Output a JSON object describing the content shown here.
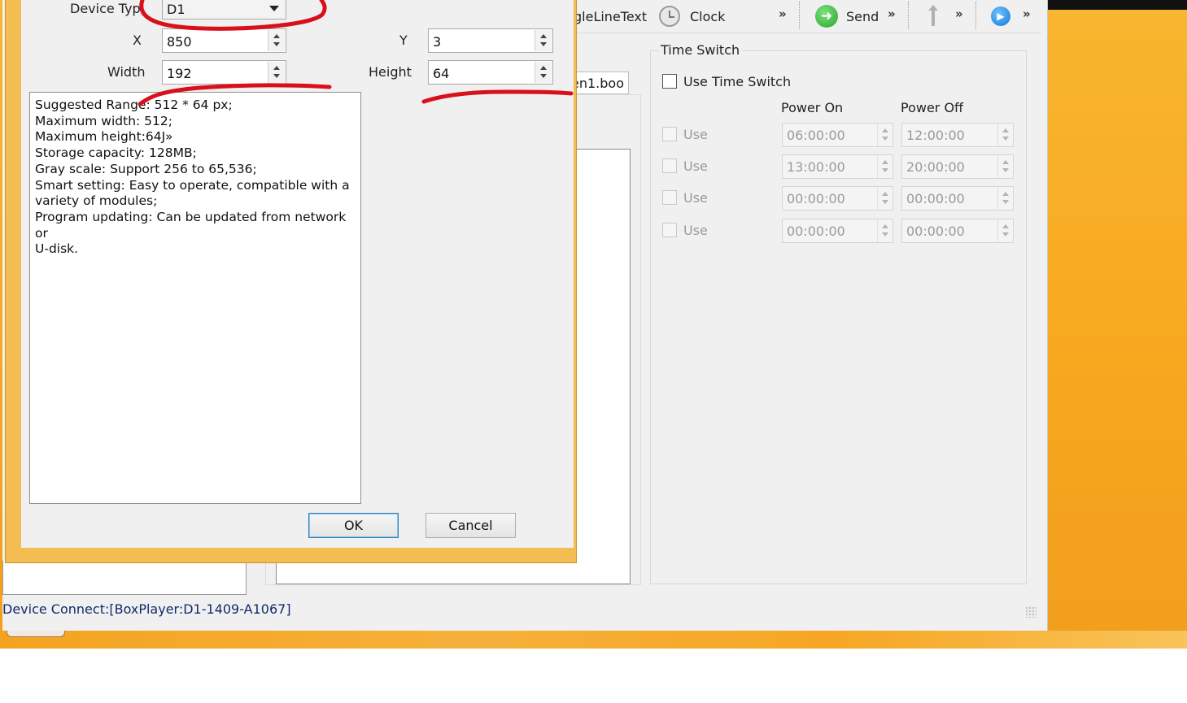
{
  "colors": {
    "desktop": "#f9b630",
    "dialog_frame": "#f3bd52",
    "annotation": "#d8101c",
    "status_text": "#102a6b"
  },
  "toolbar": {
    "singleline_label": "gleLineText",
    "clock_label": "Clock",
    "send_label": "Send",
    "more": "»",
    "icons": [
      "clock-icon",
      "send-arrow-icon",
      "upload-icon",
      "play-icon"
    ]
  },
  "file_field": {
    "value": "en1.boo"
  },
  "time_switch": {
    "title": "Time Switch",
    "use_time_switch_label": "Use Time Switch",
    "use_time_switch_checked": false,
    "col_power_on": "Power On",
    "col_power_off": "Power Off",
    "rows": [
      {
        "use_label": "Use",
        "on": "06:00:00",
        "off": "12:00:00"
      },
      {
        "use_label": "Use",
        "on": "13:00:00",
        "off": "20:00:00"
      },
      {
        "use_label": "Use",
        "on": "00:00:00",
        "off": "00:00:00"
      },
      {
        "use_label": "Use",
        "on": "00:00:00",
        "off": "00:00:00"
      }
    ]
  },
  "status_bar": {
    "text": "Device Connect:[BoxPlayer:D1-1409-A1067]"
  },
  "dialog": {
    "device_type_label": "Device Typ",
    "device_type_value": "D1",
    "x_label": "X",
    "x_value": "850",
    "y_label": "Y",
    "y_value": "3",
    "width_label": "Width",
    "width_value": "192",
    "height_label": "Height",
    "height_value": "64",
    "description": [
      "Suggested Range: 512 * 64 px;",
      "Maximum width: 512;",
      "Maximum height:64J»",
      "Storage capacity: 128MB;",
      "Gray scale: Support 256 to 65,536;",
      "Smart setting: Easy to operate, compatible with a",
      "variety of modules;",
      "Program updating: Can be updated from network or",
      "U-disk."
    ],
    "ok_label": "OK",
    "cancel_label": "Cancel"
  }
}
